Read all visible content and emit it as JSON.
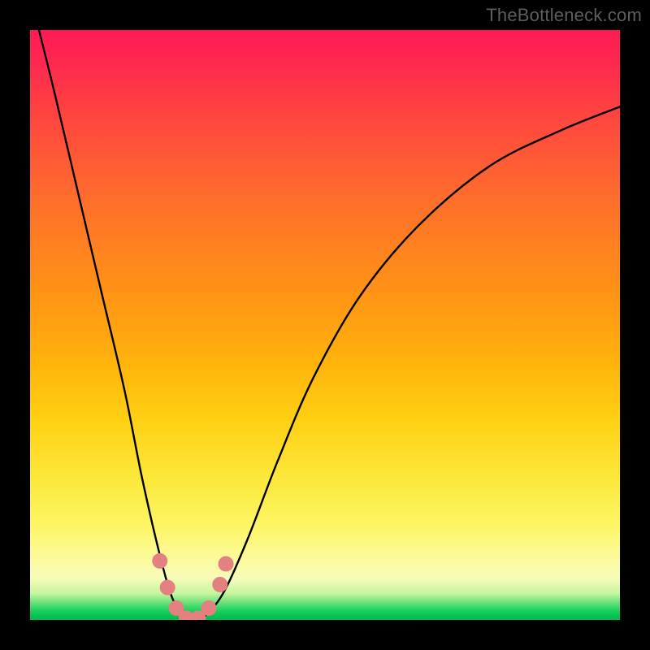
{
  "watermark": {
    "text": "TheBottleneck.com"
  },
  "colors": {
    "frame": "#000000",
    "curve": "#000000",
    "markers": "#e48080",
    "watermark": "#5d5d5d"
  },
  "chart_data": {
    "type": "line",
    "title": "",
    "xlabel": "",
    "ylabel": "",
    "xlim": [
      0,
      100
    ],
    "ylim": [
      0,
      100
    ],
    "grid": false,
    "series": [
      {
        "name": "bottleneck-curve",
        "x": [
          0,
          4,
          8,
          12,
          16,
          19,
          22,
          24,
          26,
          28,
          30,
          33,
          37,
          42,
          48,
          56,
          66,
          78,
          90,
          100
        ],
        "y": [
          106,
          90,
          73,
          56,
          39,
          24,
          11,
          4,
          0.5,
          0,
          1,
          5,
          14,
          27,
          41,
          55,
          67,
          77,
          83,
          87
        ]
      }
    ],
    "markers": [
      {
        "x": 22.0,
        "y": 10.0
      },
      {
        "x": 23.3,
        "y": 5.5
      },
      {
        "x": 24.8,
        "y": 2.0
      },
      {
        "x": 26.5,
        "y": 0.3
      },
      {
        "x": 28.5,
        "y": 0.3
      },
      {
        "x": 30.3,
        "y": 2.0
      },
      {
        "x": 32.2,
        "y": 6.0
      },
      {
        "x": 33.2,
        "y": 9.5
      }
    ],
    "gradient_stops": [
      {
        "pct": 0,
        "color": "#ff1a55"
      },
      {
        "pct": 50,
        "color": "#ff9714"
      },
      {
        "pct": 84,
        "color": "#fdf564"
      },
      {
        "pct": 100,
        "color": "#00bb52"
      }
    ]
  }
}
